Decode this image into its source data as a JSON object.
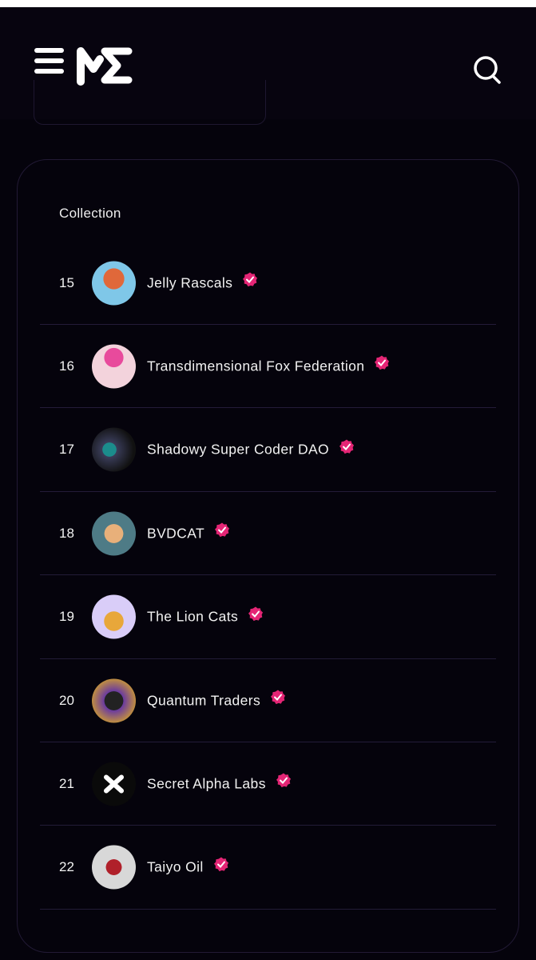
{
  "header": {
    "logo": "ME",
    "menu_icon": "hamburger-icon",
    "search_icon": "search-icon"
  },
  "table": {
    "column_header": "Collection",
    "verified_color": "#e42575",
    "rows": [
      {
        "rank": "15",
        "name": "Jelly Rascals",
        "avatar": "#7fc7e8"
      },
      {
        "rank": "16",
        "name": "Transdimensional Fox Federation",
        "avatar": "#f3d3dc"
      },
      {
        "rank": "17",
        "name": "Shadowy Super Coder DAO",
        "avatar": "#3a3d5a"
      },
      {
        "rank": "18",
        "name": "BVDCAT",
        "avatar": "#4e7b86"
      },
      {
        "rank": "19",
        "name": "The Lion Cats",
        "avatar": "#d9cdf8"
      },
      {
        "rank": "20",
        "name": "Quantum Traders",
        "avatar": "#6a3aa0"
      },
      {
        "rank": "21",
        "name": "Secret Alpha Labs",
        "avatar": "#0a0a0a"
      },
      {
        "rank": "22",
        "name": "Taiyo Oil",
        "avatar": "#d8d8d8"
      }
    ]
  }
}
